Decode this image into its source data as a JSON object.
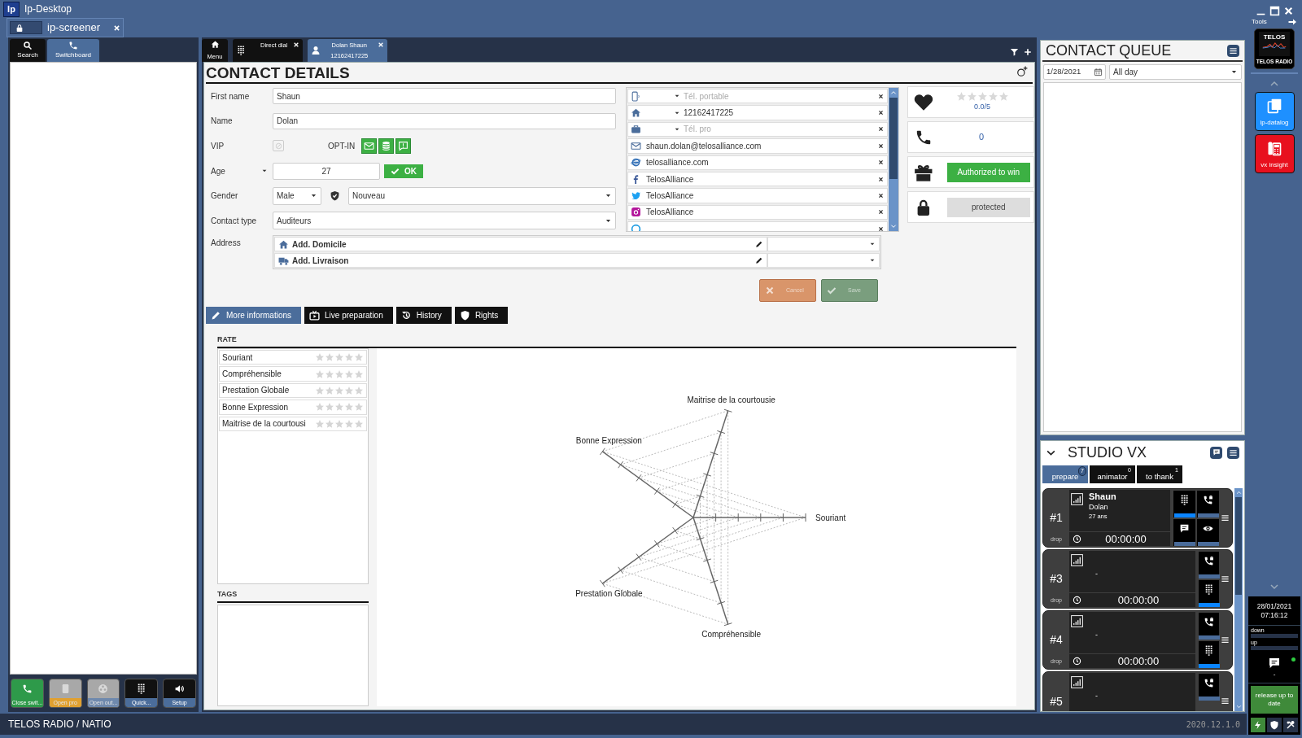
{
  "window": {
    "app_badge": "Ip",
    "title": "Ip-Desktop",
    "tab": {
      "label": "ip-screener",
      "locked": true
    }
  },
  "left_panel": {
    "tabs": [
      {
        "label": "Search",
        "kind": "search",
        "selected": false
      },
      {
        "label": "Switchboard",
        "kind": "switchboard",
        "selected": true
      }
    ],
    "actions": [
      {
        "label": "Close swit...",
        "kind": "close_switchboard",
        "color": "#2e9a4a",
        "disabled": false
      },
      {
        "label": "Open pro",
        "kind": "open_pro",
        "color": "#e0a030",
        "disabled": true
      },
      {
        "label": "Open out...",
        "kind": "open_out",
        "color": "#6f89ad",
        "disabled": true
      },
      {
        "label": "Quick...",
        "kind": "quick",
        "color": "#4b6d9b",
        "disabled": false
      },
      {
        "label": "Setup",
        "kind": "setup",
        "color": "#4b6d9b",
        "disabled": false
      }
    ]
  },
  "main_tabs": [
    {
      "label": "Menu",
      "kind": "menu",
      "selected": false
    },
    {
      "label": "Direct dial",
      "kind": "direct_dial",
      "closable": true,
      "selected": false
    },
    {
      "label": "Dolan Shaun",
      "sublabel": "12162417225",
      "kind": "contact",
      "closable": true,
      "selected": true
    }
  ],
  "contact_details": {
    "title": "CONTACT DETAILS",
    "first_name": {
      "label": "First name",
      "value": "Shaun"
    },
    "name": {
      "label": "Name",
      "value": "Dolan"
    },
    "vip": {
      "label": "VIP",
      "checked": false
    },
    "opt_in": {
      "label": "OPT-IN",
      "channels": [
        {
          "kind": "mail",
          "on": true
        },
        {
          "kind": "database",
          "on": true
        },
        {
          "kind": "sms",
          "on": true
        }
      ]
    },
    "age": {
      "label": "Age",
      "value": "27",
      "button": "OK"
    },
    "gender": {
      "label": "Gender",
      "value": "Male"
    },
    "status": {
      "value": "Nouveau"
    },
    "contact_type": {
      "label": "Contact type",
      "value": "Auditeurs"
    },
    "address": {
      "label": "Address",
      "items": [
        {
          "kind": "home",
          "label": "Add. Domicile"
        },
        {
          "kind": "delivery",
          "label": "Add. Livraison"
        }
      ]
    },
    "channels": [
      {
        "kind": "mobile",
        "placeholder": "Tél. portable"
      },
      {
        "kind": "home_phone",
        "value": "12162417225"
      },
      {
        "kind": "work_phone",
        "placeholder": "Tél. pro"
      },
      {
        "kind": "email",
        "value": "shaun.dolan@telosalliance.com"
      },
      {
        "kind": "web",
        "value": "telosalliance.com"
      },
      {
        "kind": "facebook",
        "value": "TelosAlliance"
      },
      {
        "kind": "twitter",
        "value": "TelosAlliance"
      },
      {
        "kind": "instagram",
        "value": "TelosAlliance"
      },
      {
        "kind": "skype"
      }
    ],
    "rating": {
      "stars": 0,
      "score": "0.0/5"
    },
    "calls": {
      "count": "0"
    },
    "prize": {
      "label": "Authorized to win",
      "authorized": true
    },
    "privacy": {
      "label": "protected"
    },
    "buttons": [
      {
        "kind": "cancel",
        "label": "Cancel",
        "disabled": true
      },
      {
        "kind": "save",
        "label": "Save",
        "disabled": true
      }
    ],
    "sections": [
      {
        "label": "More informations",
        "kind": "info",
        "selected": true
      },
      {
        "label": "Live preparation",
        "kind": "live",
        "selected": false
      },
      {
        "label": "History",
        "kind": "history",
        "selected": false
      },
      {
        "label": "Rights",
        "kind": "rights",
        "selected": false
      }
    ],
    "rate": {
      "title": "RATE",
      "criteria": [
        {
          "label": "Souriant",
          "stars": 0
        },
        {
          "label": "Compréhensible",
          "stars": 0
        },
        {
          "label": "Prestation Globale",
          "stars": 0
        },
        {
          "label": "Bonne Expression",
          "stars": 0
        },
        {
          "label": "Maitrise de la courtousi",
          "stars": 0
        }
      ]
    },
    "radar": {
      "axes": [
        "Maitrise de la courtousie",
        "Bonne Expression",
        "Souriant",
        "Prestation Globale",
        "Compréhensible"
      ]
    },
    "tags": {
      "title": "TAGS"
    }
  },
  "contact_queue": {
    "title": "CONTACT QUEUE",
    "date": "1/28/2021",
    "period": "All day"
  },
  "studio": {
    "title": "STUDIO VX",
    "expanded": true,
    "tabs": [
      {
        "label": "prepare",
        "count": "7",
        "selected": true
      },
      {
        "label": "animator",
        "count": "0",
        "selected": false
      },
      {
        "label": "to thank",
        "count": "1",
        "selected": false
      }
    ],
    "lines": [
      {
        "number": "#1",
        "first_name": "Shaun",
        "last_name": "Dolan",
        "age": "27 ans",
        "drop": "drop",
        "timer": "00:00:00",
        "buttons": [
          {
            "kind": "keypad",
            "active": true
          },
          {
            "kind": "hold",
            "active": false
          },
          {
            "kind": "chat",
            "active": false
          },
          {
            "kind": "eye",
            "active": false
          }
        ]
      },
      {
        "number": "#3",
        "caller": "-",
        "drop": "drop",
        "timer": "00:00:00",
        "buttons": [
          {
            "kind": "hold",
            "active": false
          },
          {
            "kind": "keypad",
            "active": true
          }
        ]
      },
      {
        "number": "#4",
        "caller": "-",
        "drop": "drop",
        "timer": "00:00:00",
        "buttons": [
          {
            "kind": "hold",
            "active": false
          },
          {
            "kind": "keypad",
            "active": true
          }
        ]
      },
      {
        "number": "#5",
        "caller": "-",
        "buttons": [
          {
            "kind": "hold",
            "active": false
          }
        ]
      }
    ]
  },
  "launcher": {
    "tools_label": "Tools",
    "apps": [
      {
        "kind": "logo",
        "logo_text": "TELOS",
        "label": "TELOS RADIO"
      },
      {
        "kind": "datalog",
        "label": "ip-datalog",
        "color": "#1e90ff"
      },
      {
        "kind": "insight",
        "label": "vx insight",
        "color": "#e8101e"
      }
    ],
    "clock": {
      "date": "28/01/2021",
      "time": "07:16:12"
    },
    "meters": [
      {
        "label": "down",
        "level": 0
      },
      {
        "label": "up",
        "level": 0
      }
    ],
    "messages": {
      "online": true,
      "text": "-"
    },
    "update_button": "release up to date",
    "system_icons": [
      {
        "kind": "power",
        "active": true
      },
      {
        "kind": "shield",
        "active": false
      },
      {
        "kind": "tools",
        "active": false
      }
    ]
  },
  "status_bar": {
    "text": "TELOS RADIO / NATIO",
    "version": "2020.12.1.0"
  }
}
